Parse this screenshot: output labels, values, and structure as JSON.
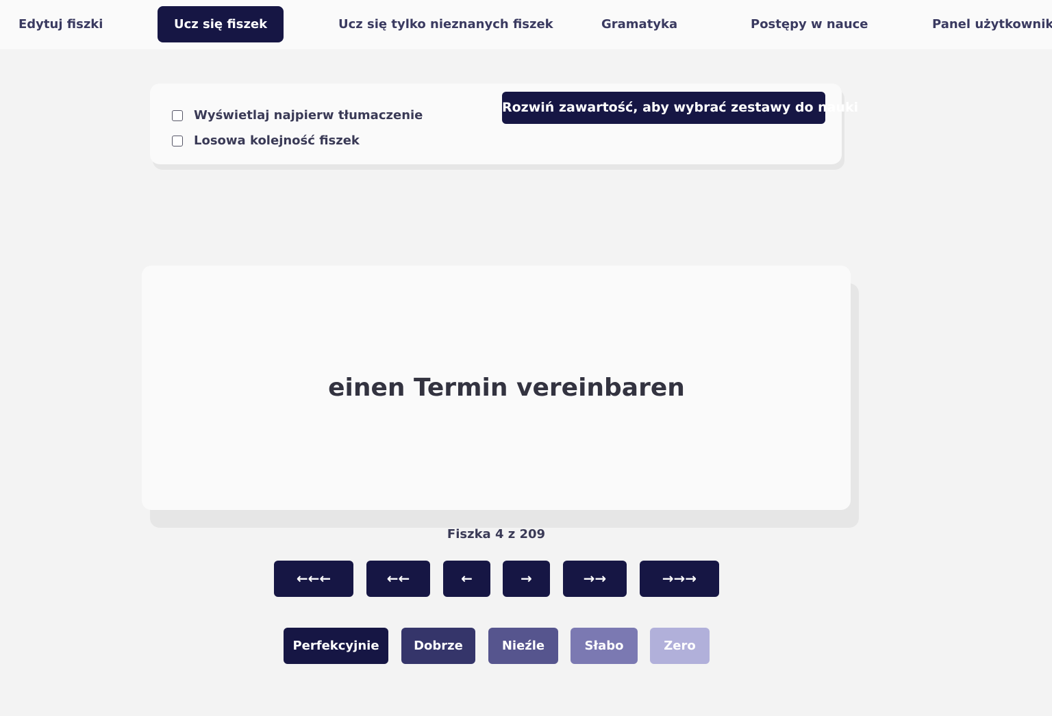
{
  "nav": {
    "items": [
      {
        "label": "Edytuj fiszki",
        "active": false
      },
      {
        "label": "Ucz się fiszek",
        "active": true
      },
      {
        "label": "Ucz się tylko nieznanych fiszek",
        "active": false
      },
      {
        "label": "Gramatyka",
        "active": false
      },
      {
        "label": "Postępy w nauce",
        "active": false
      },
      {
        "label": "Panel użytkownika",
        "active": false
      }
    ]
  },
  "options": {
    "show_translation_first": {
      "label": "Wyświetlaj najpierw tłumaczenie",
      "checked": false
    },
    "random_order": {
      "label": "Losowa kolejność fiszek",
      "checked": false
    },
    "expand_button": "Rozwiń zawartość, aby wybrać zestawy do nauki"
  },
  "card": {
    "term": "einen Termin vereinbaren"
  },
  "counter": "Fiszka 4 z 209",
  "navigation_buttons": [
    {
      "label": "←←←"
    },
    {
      "label": "←←"
    },
    {
      "label": "←"
    },
    {
      "label": "→"
    },
    {
      "label": "→→"
    },
    {
      "label": "→→→"
    }
  ],
  "rating_buttons": [
    {
      "label": "Perfekcyjnie",
      "color": "#161644"
    },
    {
      "label": "Dobrze",
      "color": "#35356a"
    },
    {
      "label": "Nieźle",
      "color": "#56558e"
    },
    {
      "label": "Słabo",
      "color": "#7b79b2"
    },
    {
      "label": "Zero",
      "color": "#b1b0da"
    }
  ],
  "colors": {
    "accent": "#161644",
    "background": "#f3f3f3",
    "panel": "#fafafa"
  }
}
